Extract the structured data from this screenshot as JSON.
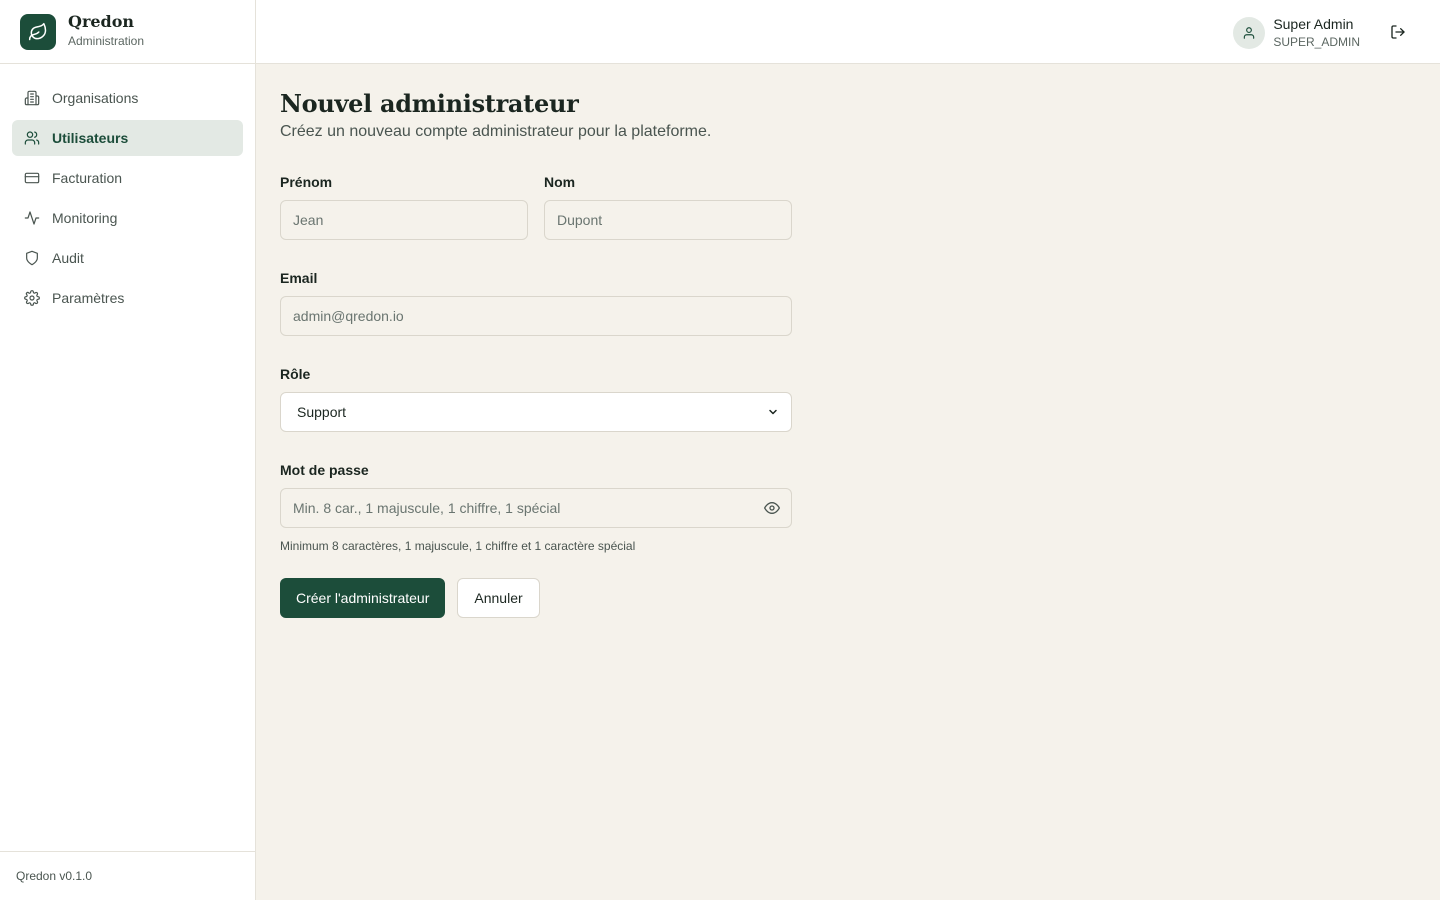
{
  "brand": {
    "name": "Qredon",
    "subtitle": "Administration"
  },
  "sidebar": {
    "items": [
      {
        "label": "Organisations",
        "icon": "building-icon",
        "active": false
      },
      {
        "label": "Utilisateurs",
        "icon": "users-icon",
        "active": true
      },
      {
        "label": "Facturation",
        "icon": "credit-card-icon",
        "active": false
      },
      {
        "label": "Monitoring",
        "icon": "activity-icon",
        "active": false
      },
      {
        "label": "Audit",
        "icon": "shield-icon",
        "active": false
      },
      {
        "label": "Paramètres",
        "icon": "gear-icon",
        "active": false
      }
    ],
    "footer": "Qredon v0.1.0"
  },
  "header": {
    "user_name": "Super Admin",
    "user_role": "SUPER_ADMIN"
  },
  "page": {
    "title": "Nouvel administrateur",
    "subtitle": "Créez un nouveau compte administrateur pour la plateforme."
  },
  "form": {
    "first_name": {
      "label": "Prénom",
      "placeholder": "Jean",
      "value": ""
    },
    "last_name": {
      "label": "Nom",
      "placeholder": "Dupont",
      "value": ""
    },
    "email": {
      "label": "Email",
      "placeholder": "admin@qredon.io",
      "value": ""
    },
    "role": {
      "label": "Rôle",
      "selected": "Support"
    },
    "password": {
      "label": "Mot de passe",
      "placeholder": "Min. 8 car., 1 majuscule, 1 chiffre, 1 spécial",
      "hint": "Minimum 8 caractères, 1 majuscule, 1 chiffre et 1 caractère spécial"
    },
    "submit_label": "Créer l'administrateur",
    "cancel_label": "Annuler"
  },
  "colors": {
    "accent": "#1c4d3a",
    "background": "#f5f2eb",
    "active_nav_bg": "#e3e9e4"
  }
}
